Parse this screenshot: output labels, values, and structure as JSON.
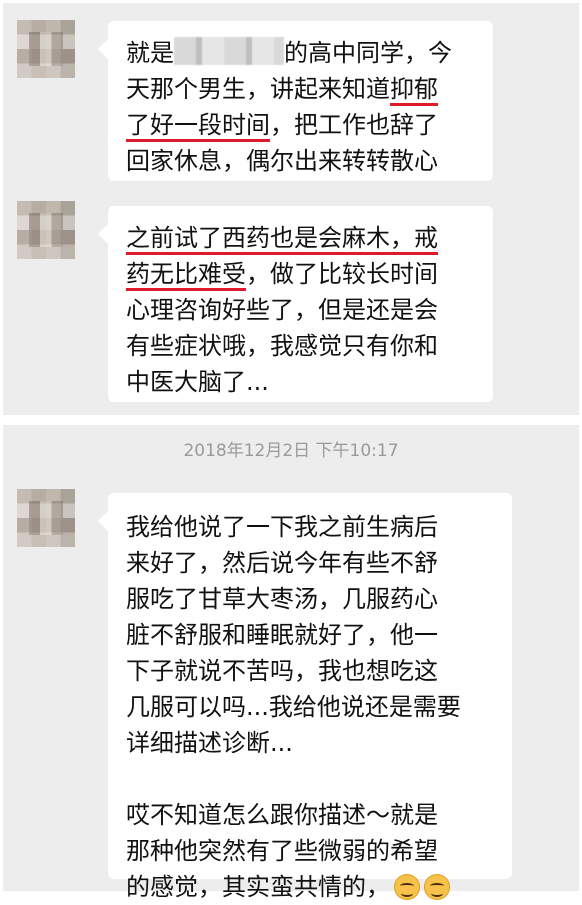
{
  "messages": [
    {
      "lines": [
        {
          "before_blur": "就是",
          "after_blur": "的高中同学，今"
        },
        {
          "text_a": "天那个男生，讲起来知道",
          "underlined": "抑郁"
        },
        {
          "underlined": "了好一段时间",
          "text_b": "，把工作也辞了"
        },
        {
          "text": "回家休息，偶尔出来转转散心"
        }
      ]
    },
    {
      "lines": [
        {
          "underlined": "之前试了西药也是会麻木，戒"
        },
        {
          "underlined": "药无比难受",
          "text_b": "，做了比较长时间"
        },
        {
          "text": "心理咨询好些了，但是还是会"
        },
        {
          "text": "有些症状哦，我感觉只有你和"
        },
        {
          "text": "中医大脑了..."
        }
      ]
    },
    {
      "lines": [
        {
          "text": "我给他说了一下我之前生病后"
        },
        {
          "text": "来好了，然后说今年有些不舒"
        },
        {
          "text": "服吃了甘草大枣汤，几服药心"
        },
        {
          "text": "脏不舒服和睡眠就好了，他一"
        },
        {
          "text": "下子就说不苦吗，我也想吃这"
        },
        {
          "text": "几服可以吗...我给他说还是需要"
        },
        {
          "text": "详细描述诊断..."
        },
        {
          "text": ""
        },
        {
          "text": "哎不知道怎么跟你描述～就是"
        },
        {
          "text": "那种他突然有了些微弱的希望"
        },
        {
          "text": "的感觉，其实蛮共情的，"
        }
      ]
    }
  ],
  "timestamp": "2018年12月2日 下午10:17",
  "emojis": [
    "smiling-face-emoji",
    "smiling-face-emoji"
  ],
  "colors": {
    "underline": "#e0192d",
    "panel_bg": "#ededed",
    "bubble_bg": "#ffffff",
    "timestamp": "#9a9a9a"
  }
}
